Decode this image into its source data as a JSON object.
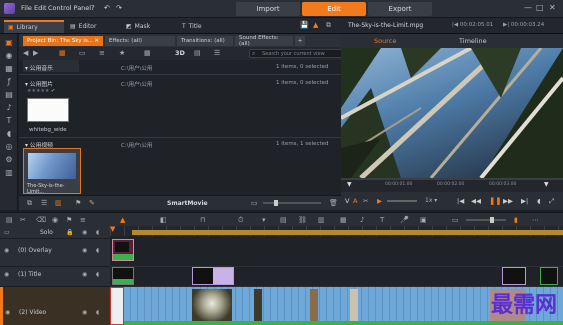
{
  "menu": {
    "file": "File",
    "edit": "Edit",
    "control_panel": "Control Panel"
  },
  "modes": {
    "import": "Import",
    "edit": "Edit",
    "export": "Export"
  },
  "top_tabs": {
    "library": "Library",
    "editor": "Editor",
    "mask": "Mask",
    "title": "Title"
  },
  "preview_header": {
    "filename": "The-Sky-is-the-Limit.mpg",
    "timecode_left": "00:02:05.01",
    "timecode_right": "00:00:03.24"
  },
  "library_tabs": [
    "Project Bin: The Sky is...",
    "Effects: (all)",
    "Transitions: (all)",
    "Sound Effects: (all)"
  ],
  "library_toolbar": {
    "mode_3d": "3D",
    "search_placeholder": "Search your current view"
  },
  "groups": [
    {
      "name": "公用音乐",
      "path": "C:\\用户\\公用",
      "count": "1 items, 0 selected"
    },
    {
      "name": "公用图片",
      "path": "C:\\用户\\公用",
      "count": "1 items, 0 selected"
    },
    {
      "name": "公用视频",
      "path": "C:\\用户\\公用",
      "count": "1 items, 1 selected"
    }
  ],
  "thumbs": {
    "image": "whitebg_wide",
    "video": "The-Sky-is-the-Limit..."
  },
  "library_bottom": {
    "smartmovie": "SmartMovie"
  },
  "preview_tabs": {
    "source": "Source",
    "timeline": "Timeline"
  },
  "ruler_times": [
    "00:00:01.00",
    "00:00:02.00",
    "00:00:03.00"
  ],
  "preview_ctl": {
    "fps": "1x"
  },
  "tracks": [
    {
      "num": "",
      "name": "Solo"
    },
    {
      "num": "(0)",
      "name": "Overlay"
    },
    {
      "num": "(1)",
      "name": "Title"
    },
    {
      "num": "(2)",
      "name": "Video"
    }
  ],
  "watermark": "最需网",
  "colors": {
    "accent": "#f07a1c",
    "panel": "#1f2227",
    "clip_blue": "#6ea8d8"
  }
}
